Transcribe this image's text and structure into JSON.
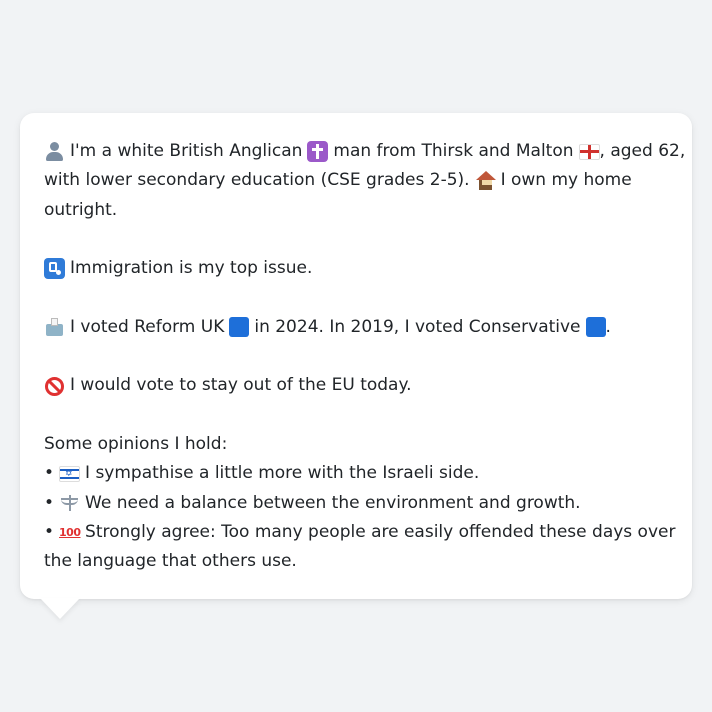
{
  "profile": {
    "line1_a": "I'm a white British Anglican",
    "line1_b": "man from Thirsk and Malton",
    "line1_c": ", aged 62,",
    "line2_a": "with lower secondary education (CSE grades 2-5).",
    "line2_b": "I own my home",
    "line3": "outright.",
    "issue": "Immigration is my top issue.",
    "vote_a": "I voted Reform UK",
    "vote_b": "in 2024. In 2019, I voted Conservative",
    "vote_c": ".",
    "eu": "I would vote to stay out of the EU today.",
    "opinions_heading": "Some opinions I hold:",
    "bullet": "•",
    "opinion1": "I sympathise a little more with the Israeli side.",
    "opinion2": "We need a balance between the environment and growth.",
    "opinion3_a": "Strongly agree: Too many people are easily offended these days over",
    "opinion3_b": "the language that others use.",
    "hundred_icon_text": "100"
  },
  "icons": {
    "person": "person-icon",
    "cross": "latin-cross-icon",
    "england_flag": "england-flag-icon",
    "house": "house-icon",
    "passport": "passport-control-icon",
    "ballot": "ballot-box-icon",
    "blue_square": "blue-square-icon",
    "prohibited": "prohibited-icon",
    "israel_flag": "israel-flag-icon",
    "scales": "balance-scale-icon",
    "hundred": "hundred-points-icon"
  },
  "colors": {
    "background": "#f1f3f5",
    "bubble": "#ffffff",
    "text": "#212529",
    "party_blue": "#1e6fd9"
  }
}
